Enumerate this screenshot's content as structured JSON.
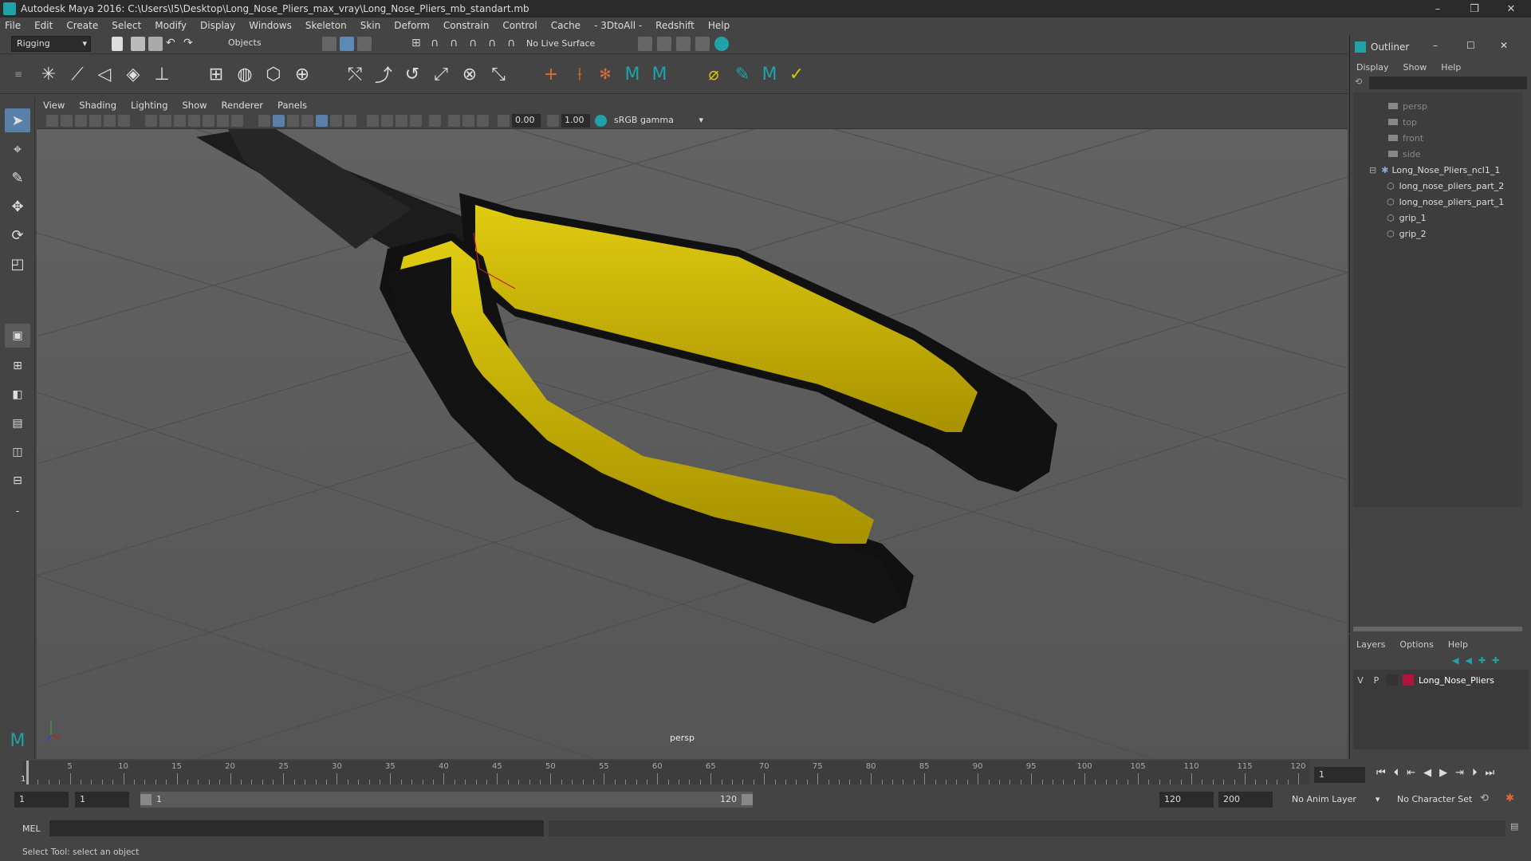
{
  "window": {
    "title": "Autodesk Maya 2016: C:\\Users\\I5\\Desktop\\Long_Nose_Pliers_max_vray\\Long_Nose_Pliers_mb_standart.mb",
    "controls": [
      "–",
      "❐",
      "✕"
    ]
  },
  "menubar": [
    "File",
    "Edit",
    "Create",
    "Select",
    "Modify",
    "Display",
    "Windows",
    "Skeleton",
    "Skin",
    "Deform",
    "Constrain",
    "Control",
    "Cache",
    "- 3DtoAll -",
    "Redshift",
    "Help"
  ],
  "statusline": {
    "menuset": "Rigging",
    "selection_mode": "Objects",
    "live_surface": "No Live Surface"
  },
  "panel": {
    "menus": [
      "View",
      "Shading",
      "Lighting",
      "Show",
      "Renderer",
      "Panels"
    ],
    "exposure": "0.00",
    "gamma": "1.00",
    "color_space": "sRGB gamma",
    "camera_label": "persp"
  },
  "outliner": {
    "title": "Outliner",
    "menus": [
      "Display",
      "Show",
      "Help"
    ],
    "cameras": [
      "persp",
      "top",
      "front",
      "side"
    ],
    "group": "Long_Nose_Pliers_ncl1_1",
    "children": [
      "long_nose_pliers_part_2",
      "long_nose_pliers_part_1",
      "grip_1",
      "grip_2"
    ]
  },
  "layers": {
    "menus": [
      "Layers",
      "Options",
      "Help"
    ],
    "layer": {
      "v": "V",
      "p": "P",
      "name": "Long_Nose_Pliers",
      "color": "#b0143a"
    }
  },
  "timeline": {
    "ticks": [
      "5",
      "10",
      "15",
      "20",
      "25",
      "30",
      "35",
      "40",
      "45",
      "50",
      "55",
      "60",
      "65",
      "70",
      "75",
      "80",
      "85",
      "90",
      "95",
      "100",
      "105",
      "110",
      "115",
      "120"
    ],
    "start_label": "1",
    "current_frame": "1"
  },
  "range": {
    "start": "1",
    "playback_start": "1",
    "slider_start": "1",
    "slider_end": "120",
    "playback_end": "120",
    "end": "200",
    "anim_layer": "No Anim Layer",
    "character_set": "No Character Set"
  },
  "command": {
    "label": "MEL"
  },
  "helpline": "Select Tool: select an object",
  "colors": {
    "accent": "#1fa3a8",
    "grip_yellow": "#c9b000",
    "grip_black": "#151515"
  }
}
